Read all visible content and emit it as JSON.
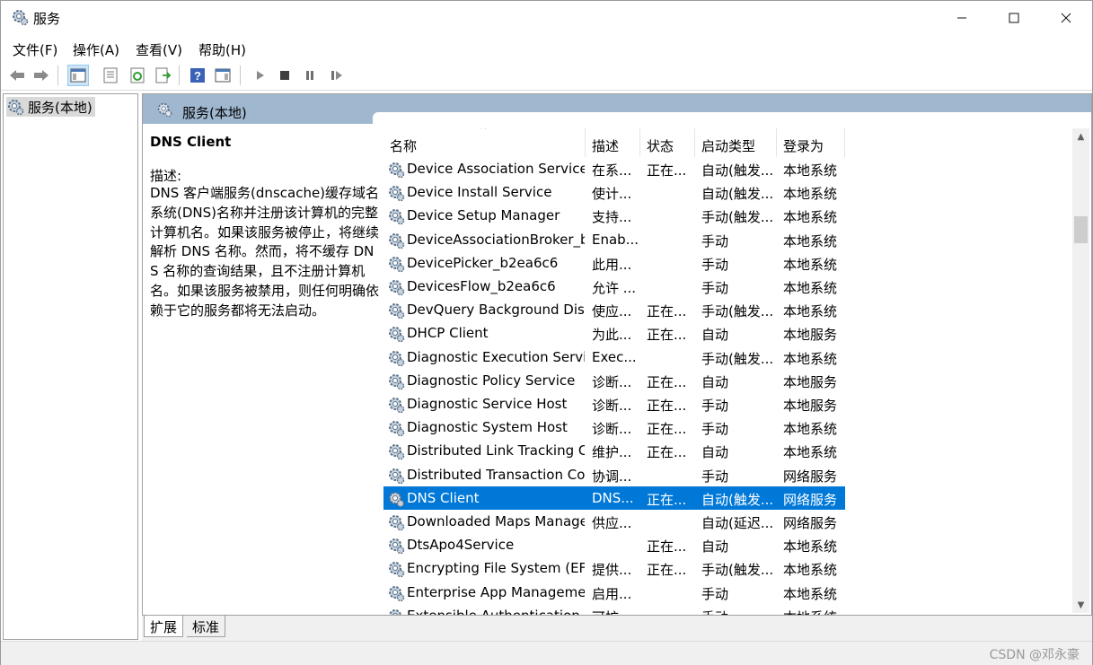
{
  "window": {
    "title": "服务"
  },
  "menu": [
    "文件(F)",
    "操作(A)",
    "查看(V)",
    "帮助(H)"
  ],
  "toolbar": {
    "icons": [
      "back-arrow-icon",
      "forward-arrow-icon",
      "show-hide-console-tree-icon",
      "properties-icon",
      "refresh-icon",
      "export-list-icon",
      "help-icon",
      "show-action-pane-icon",
      "start-icon",
      "stop-icon",
      "pause-icon",
      "restart-icon"
    ]
  },
  "tree": {
    "root_label": "服务(本地)"
  },
  "content": {
    "header_title": "服务(本地)",
    "selected_service": "DNS Client",
    "desc_label": "描述:",
    "description": "DNS 客户端服务(dnscache)缓存域名系统(DNS)名称并注册该计算机的完整计算机名。如果该服务被停止，将继续解析 DNS 名称。然而，将不缓存 DNS 名称的查询结果，且不注册计算机名。如果该服务被禁用，则任何明确依赖于它的服务都将无法启动。"
  },
  "columns": [
    "名称",
    "描述",
    "状态",
    "启动类型",
    "登录为"
  ],
  "rows": [
    {
      "name": "Device Association Service",
      "desc": "在系...",
      "status": "正在...",
      "start": "自动(触发...",
      "logon": "本地系统"
    },
    {
      "name": "Device Install Service",
      "desc": "使计...",
      "status": "",
      "start": "自动(触发...",
      "logon": "本地系统"
    },
    {
      "name": "Device Setup Manager",
      "desc": "支持...",
      "status": "",
      "start": "手动(触发...",
      "logon": "本地系统"
    },
    {
      "name": "DeviceAssociationBroker_b...",
      "desc": "Enab...",
      "status": "",
      "start": "手动",
      "logon": "本地系统"
    },
    {
      "name": "DevicePicker_b2ea6c6",
      "desc": "此用...",
      "status": "",
      "start": "手动",
      "logon": "本地系统"
    },
    {
      "name": "DevicesFlow_b2ea6c6",
      "desc": "允许 ...",
      "status": "",
      "start": "手动",
      "logon": "本地系统"
    },
    {
      "name": "DevQuery Background Dis...",
      "desc": "使应...",
      "status": "正在...",
      "start": "手动(触发...",
      "logon": "本地系统"
    },
    {
      "name": "DHCP Client",
      "desc": "为此...",
      "status": "正在...",
      "start": "自动",
      "logon": "本地服务"
    },
    {
      "name": "Diagnostic Execution Service",
      "desc": "Exec...",
      "status": "",
      "start": "手动(触发...",
      "logon": "本地系统"
    },
    {
      "name": "Diagnostic Policy Service",
      "desc": "诊断...",
      "status": "正在...",
      "start": "自动",
      "logon": "本地服务"
    },
    {
      "name": "Diagnostic Service Host",
      "desc": "诊断...",
      "status": "正在...",
      "start": "手动",
      "logon": "本地服务"
    },
    {
      "name": "Diagnostic System Host",
      "desc": "诊断...",
      "status": "正在...",
      "start": "手动",
      "logon": "本地系统"
    },
    {
      "name": "Distributed Link Tracking C...",
      "desc": "维护...",
      "status": "正在...",
      "start": "自动",
      "logon": "本地系统"
    },
    {
      "name": "Distributed Transaction Co...",
      "desc": "协调...",
      "status": "",
      "start": "手动",
      "logon": "网络服务"
    },
    {
      "name": "DNS Client",
      "desc": "DNS...",
      "status": "正在...",
      "start": "自动(触发...",
      "logon": "网络服务",
      "selected": true
    },
    {
      "name": "Downloaded Maps Manager",
      "desc": "供应...",
      "status": "",
      "start": "自动(延迟...",
      "logon": "网络服务"
    },
    {
      "name": "DtsApo4Service",
      "desc": "",
      "status": "正在...",
      "start": "自动",
      "logon": "本地系统"
    },
    {
      "name": "Encrypting File System (EFS)",
      "desc": "提供...",
      "status": "正在...",
      "start": "手动(触发...",
      "logon": "本地系统"
    },
    {
      "name": "Enterprise App Manageme...",
      "desc": "启用...",
      "status": "",
      "start": "手动",
      "logon": "本地系统"
    },
    {
      "name": "Extensible Authentication ...",
      "desc": "可扩...",
      "status": "",
      "start": "手动",
      "logon": "本地系统"
    }
  ],
  "tabs": [
    "扩展",
    "标准"
  ],
  "watermark": "CSDN @邓永豪",
  "colors": {
    "selected_row": "#0078d7",
    "header_band": "#9fb7cf"
  }
}
